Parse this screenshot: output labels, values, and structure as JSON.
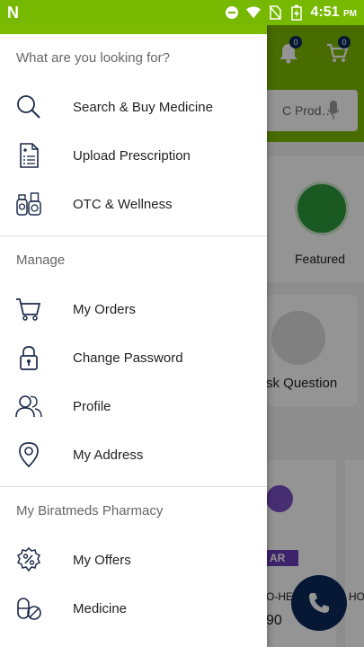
{
  "status_bar": {
    "time": "4:51",
    "ampm": "PM",
    "notification_app": "N"
  },
  "background": {
    "notifications_badge": "0",
    "cart_badge": "0",
    "search_partial": "C Prod…",
    "featured_label": "Featured",
    "ask_question_label": "sk Question",
    "promo_label": "AR",
    "product_code_1": "O-HE",
    "product_code_2": "HO",
    "price_partial": "90"
  },
  "drawer": {
    "sections": [
      {
        "title": "What are you looking for?",
        "items": [
          {
            "label": "Search & Buy Medicine",
            "icon": "search-icon"
          },
          {
            "label": "Upload Prescription",
            "icon": "prescription-icon"
          },
          {
            "label": "OTC & Wellness",
            "icon": "wellness-bottles-icon"
          }
        ]
      },
      {
        "title": "Manage",
        "items": [
          {
            "label": "My Orders",
            "icon": "cart-icon"
          },
          {
            "label": "Change Password",
            "icon": "lock-icon"
          },
          {
            "label": "Profile",
            "icon": "users-icon"
          },
          {
            "label": "My Address",
            "icon": "location-pin-icon"
          }
        ]
      },
      {
        "title": "My Biratmeds Pharmacy",
        "items": [
          {
            "label": "My Offers",
            "icon": "offer-percent-icon"
          },
          {
            "label": "Medicine",
            "icon": "pill-icon"
          }
        ]
      }
    ]
  },
  "colors": {
    "brand_green": "#7dbb00",
    "brand_navy": "#0d2a5c",
    "icon_navy": "#1b2a4a"
  }
}
